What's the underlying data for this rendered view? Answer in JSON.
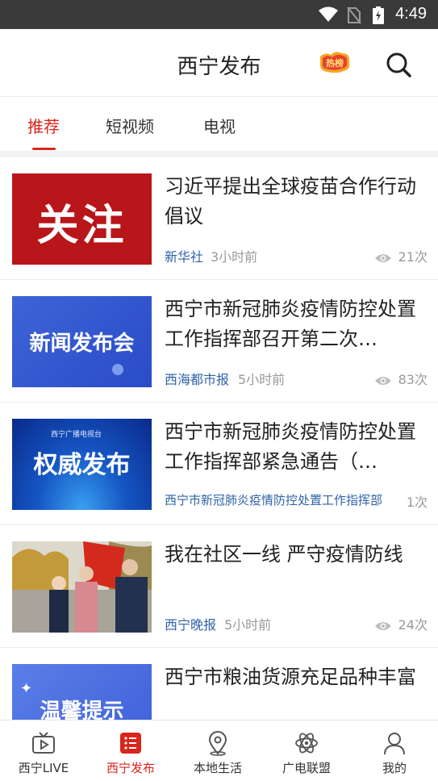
{
  "status_bar": {
    "time": "4:49"
  },
  "header": {
    "title": "西宁发布",
    "hot_badge": "热榜"
  },
  "tabs": [
    {
      "label": "推荐",
      "active": true
    },
    {
      "label": "短视频",
      "active": false
    },
    {
      "label": "电视",
      "active": false
    }
  ],
  "news": [
    {
      "thumb_text": "关注",
      "title": "习近平提出全球疫苗合作行动倡议",
      "source": "新华社",
      "time": "3小时前",
      "views": "21次"
    },
    {
      "thumb_text": "新闻发布会",
      "title": "西宁市新冠肺炎疫情防控处置工作指挥部召开第二次…",
      "source": "西海都市报",
      "time": "5小时前",
      "views": "83次"
    },
    {
      "thumb_text": "权威发布",
      "thumb_sub": "西宁广播电视台",
      "title": "西宁市新冠肺炎疫情防控处置工作指挥部紧急通告（…",
      "source": "西宁市新冠肺炎疫情防控处置工作指挥部",
      "time": "",
      "views": "1次"
    },
    {
      "thumb_text": "",
      "title": "我在社区一线 严守疫情防线",
      "source": "西宁晚报",
      "time": "5小时前",
      "views": "24次"
    },
    {
      "thumb_text": "温馨提示",
      "title": "西宁市粮油货源充足品种丰富",
      "source": "",
      "time": "",
      "views": ""
    }
  ],
  "bottom_nav": [
    {
      "label": "西宁LIVE",
      "icon": "tv-play-icon",
      "active": false
    },
    {
      "label": "西宁发布",
      "icon": "list-icon",
      "active": true
    },
    {
      "label": "本地生活",
      "icon": "location-pin-icon",
      "active": false
    },
    {
      "label": "广电联盟",
      "icon": "atom-icon",
      "active": false
    },
    {
      "label": "我的",
      "icon": "user-icon",
      "active": false
    }
  ],
  "colors": {
    "accent": "#d9251c",
    "source": "#2f63a8",
    "meta": "#999999"
  }
}
